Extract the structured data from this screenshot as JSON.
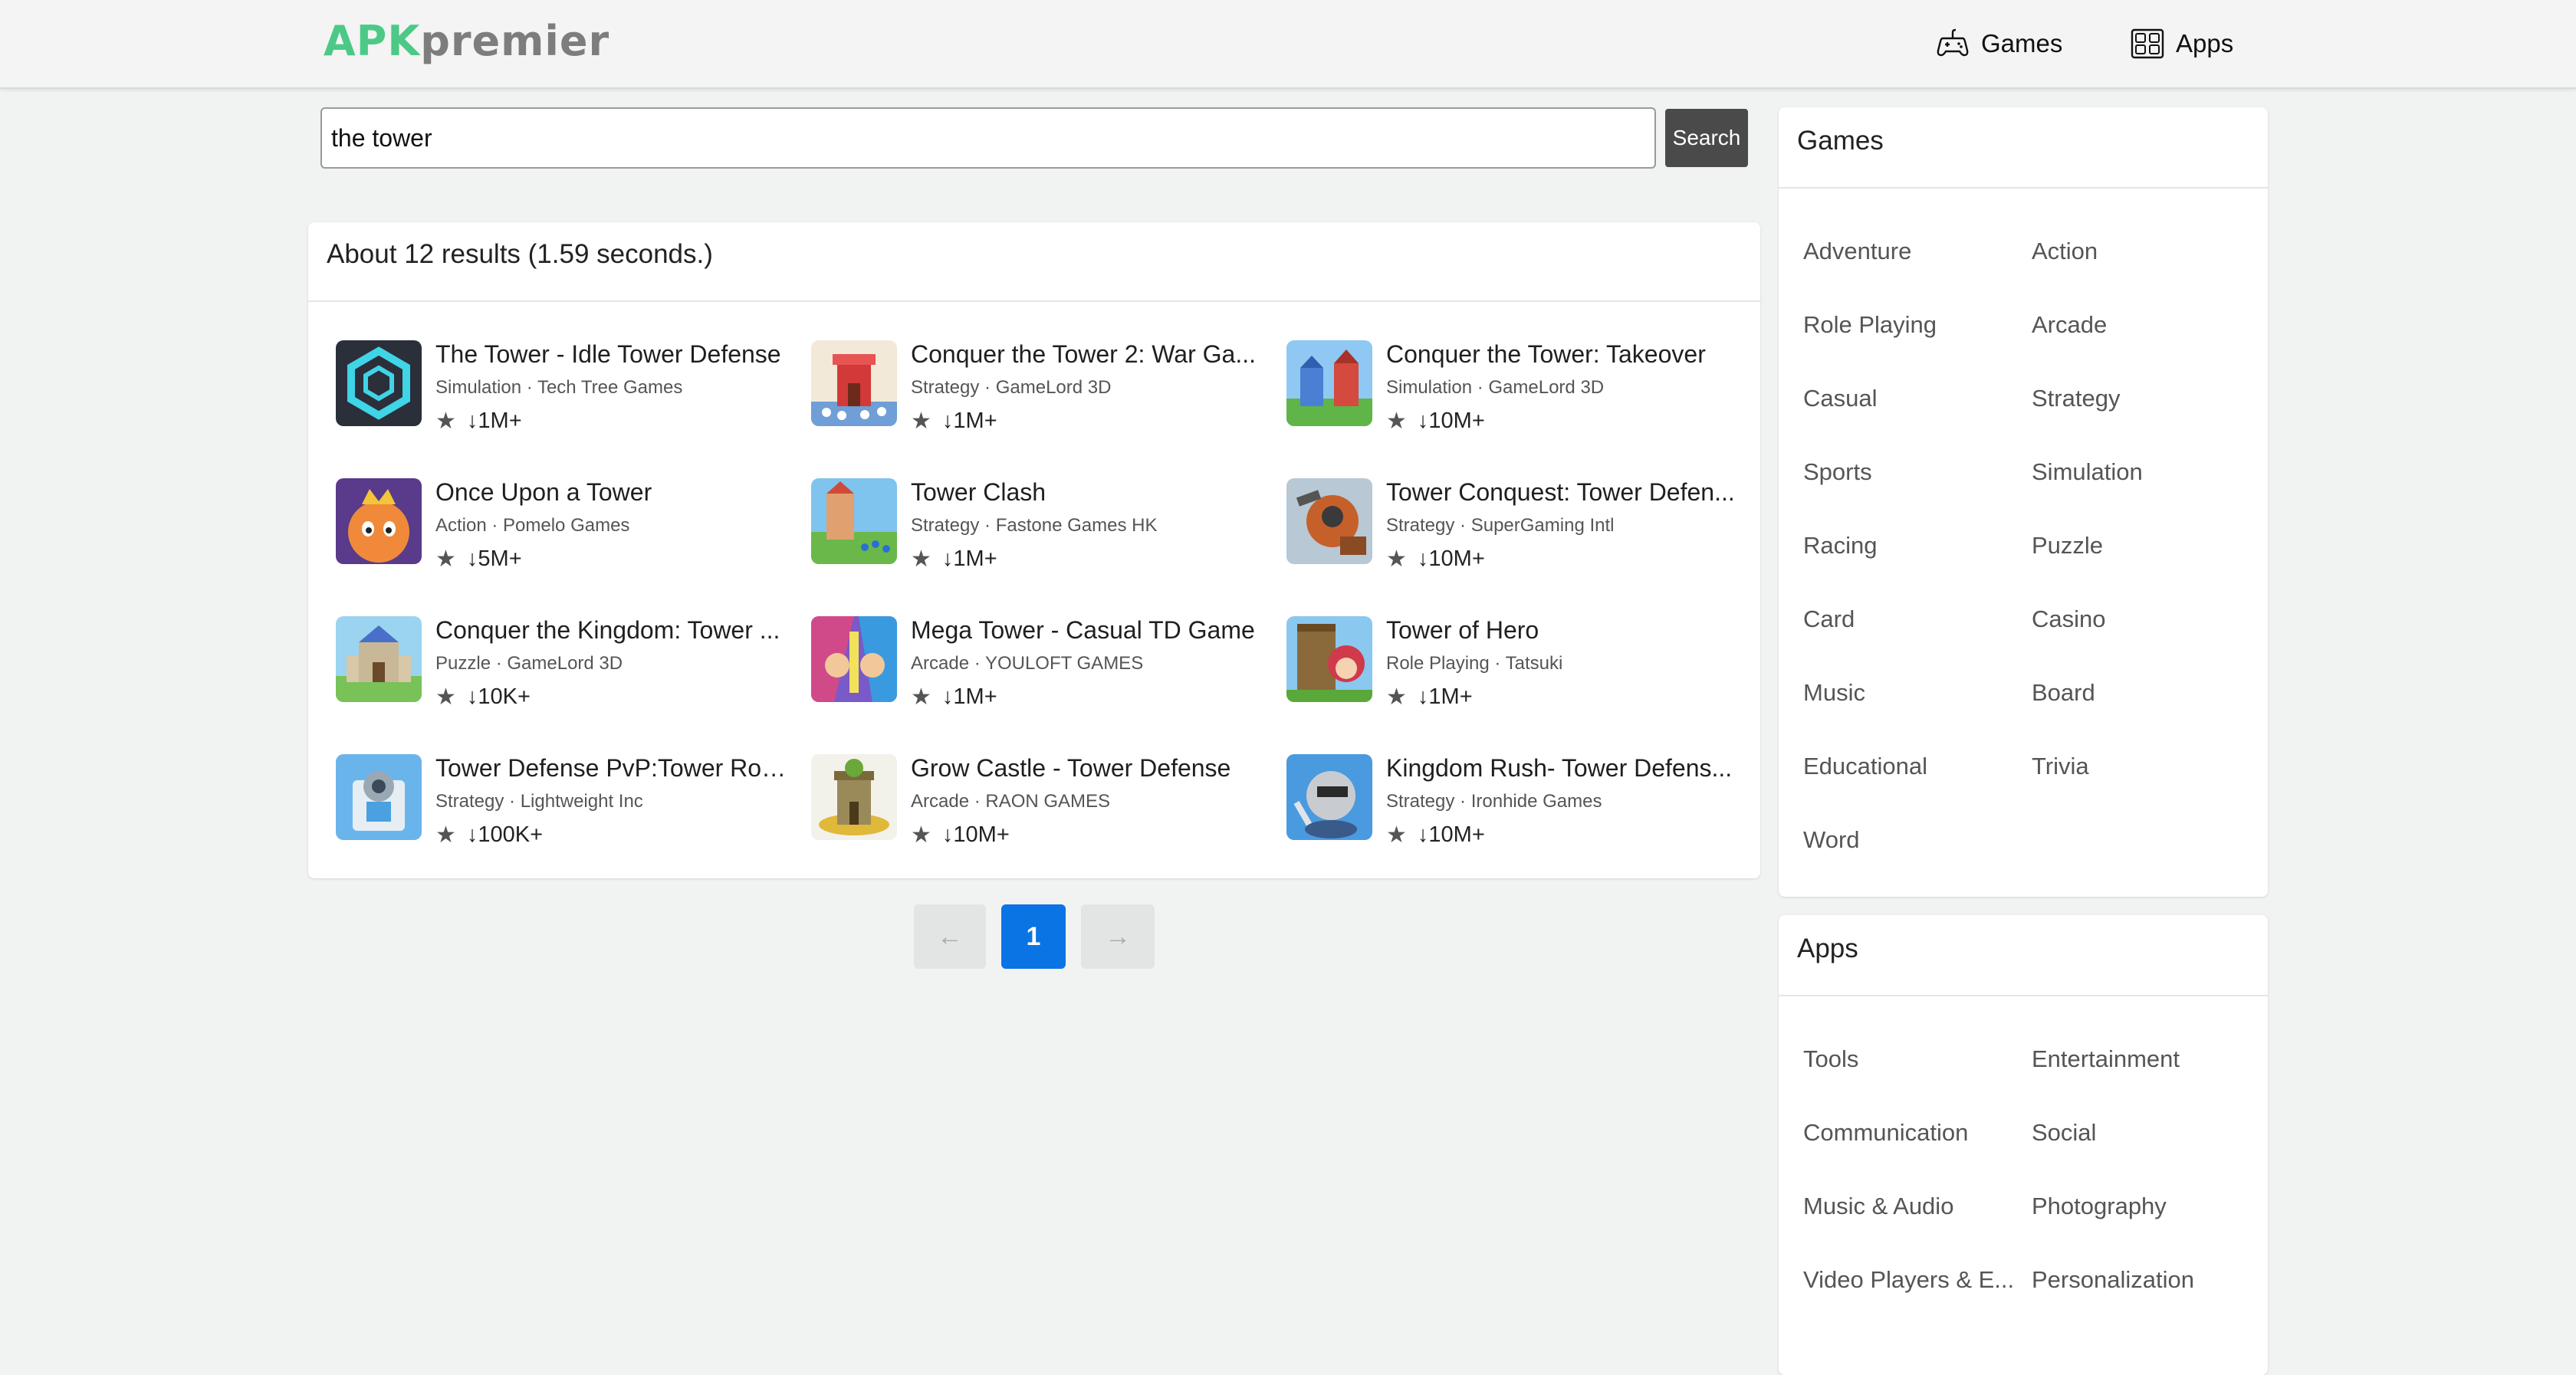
{
  "header": {
    "logo_apk": "APK",
    "logo_premier": "premier",
    "nav": [
      {
        "label": "Games",
        "icon": "gamepad-icon"
      },
      {
        "label": "Apps",
        "icon": "apps-grid-icon"
      }
    ]
  },
  "search": {
    "value": "the tower",
    "button_label": "Search"
  },
  "results": {
    "summary": "About 12 results (1.59 seconds.)",
    "items": [
      {
        "title": "The Tower - Idle Tower Defense",
        "meta": "Simulation · Tech Tree Games",
        "downloads": "1M+"
      },
      {
        "title": "Conquer the Tower 2: War Ga...",
        "meta": "Strategy · GameLord 3D",
        "downloads": "1M+"
      },
      {
        "title": "Conquer the Tower: Takeover",
        "meta": "Simulation · GameLord 3D",
        "downloads": "10M+"
      },
      {
        "title": "Once Upon a Tower",
        "meta": "Action · Pomelo Games",
        "downloads": "5M+"
      },
      {
        "title": "Tower Clash",
        "meta": "Strategy · Fastone Games HK",
        "downloads": "1M+"
      },
      {
        "title": "Tower Conquest: Tower Defen...",
        "meta": "Strategy · SuperGaming Intl",
        "downloads": "10M+"
      },
      {
        "title": "Conquer the Kingdom: Tower ...",
        "meta": "Puzzle · GameLord 3D",
        "downloads": "10K+"
      },
      {
        "title": "Mega Tower - Casual TD Game",
        "meta": "Arcade · YOULOFT GAMES",
        "downloads": "1M+"
      },
      {
        "title": "Tower of Hero",
        "meta": "Role Playing · Tatsuki",
        "downloads": "1M+"
      },
      {
        "title": "Tower Defense PvP:Tower Roy...",
        "meta": "Strategy · Lightweight Inc",
        "downloads": "100K+"
      },
      {
        "title": "Grow Castle - Tower Defense",
        "meta": "Arcade · RAON GAMES",
        "downloads": "10M+"
      },
      {
        "title": "Kingdom Rush- Tower Defens...",
        "meta": "Strategy · Ironhide Games",
        "downloads": "10M+"
      }
    ]
  },
  "pagination": {
    "prev": "←",
    "current": "1",
    "next": "→"
  },
  "sidebar": {
    "games_title": "Games",
    "games": [
      "Adventure",
      "Action",
      "Role Playing",
      "Arcade",
      "Casual",
      "Strategy",
      "Sports",
      "Simulation",
      "Racing",
      "Puzzle",
      "Card",
      "Casino",
      "Music",
      "Board",
      "Educational",
      "Trivia",
      "Word"
    ],
    "apps_title": "Apps",
    "apps": [
      "Tools",
      "Entertainment",
      "Communication",
      "Social",
      "Music & Audio",
      "Photography",
      "Video Players & E...",
      "Personalization"
    ]
  },
  "colors": {
    "logo_green": "#4cc987",
    "logo_gray": "#7d7d7d",
    "accent_blue": "#0a74e4",
    "search_button": "#4a4a4a"
  }
}
